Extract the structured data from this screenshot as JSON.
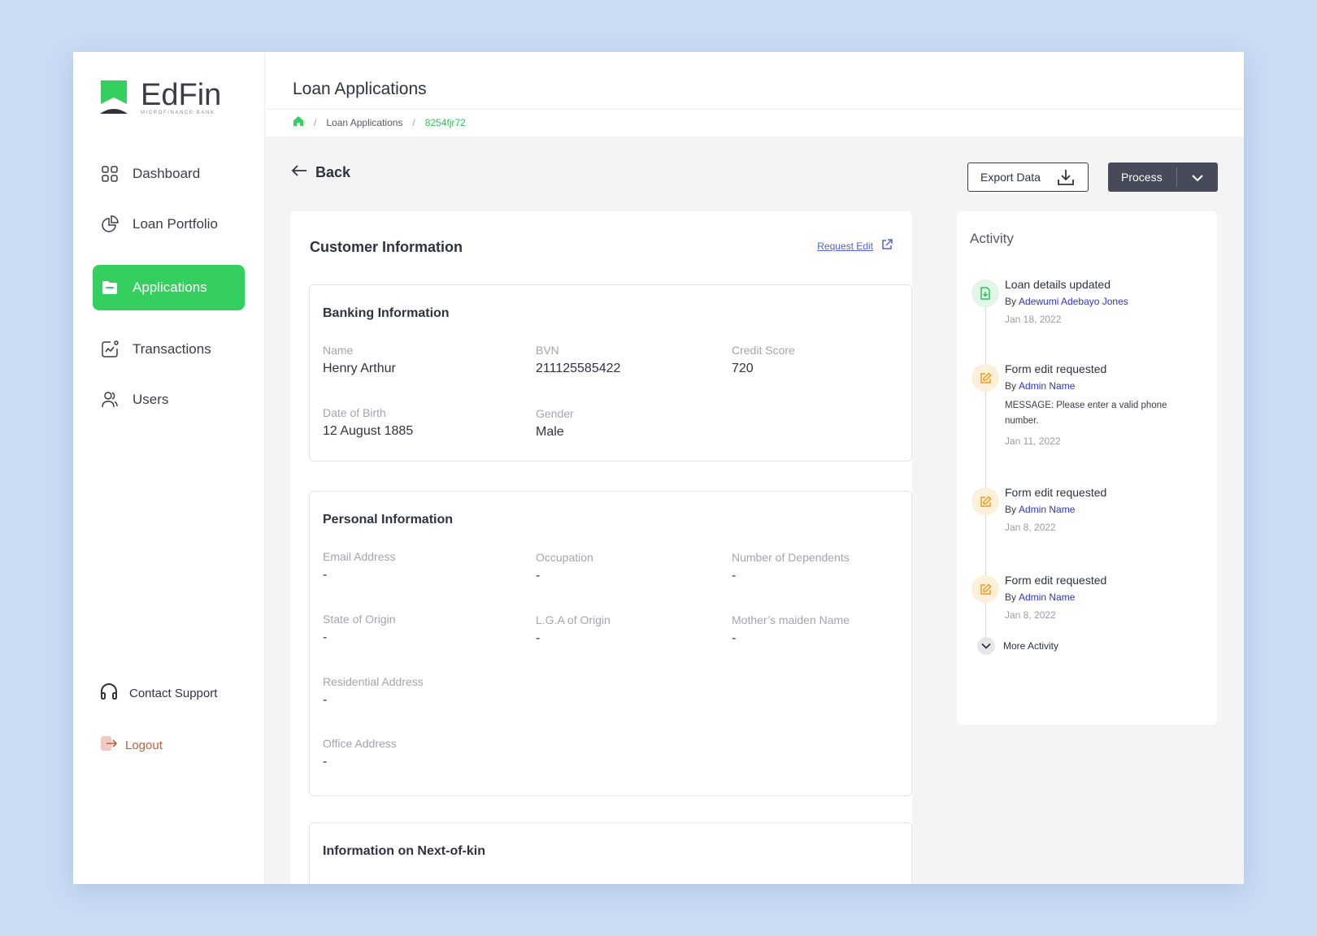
{
  "brand": {
    "name": "EdFin",
    "tagline": "MICROFINANCE BANK",
    "color": "#34cf5f"
  },
  "sidebar": {
    "items": [
      {
        "label": "Dashboard",
        "icon": "grid-icon"
      },
      {
        "label": "Loan Portfolio",
        "icon": "pie-chart-icon"
      },
      {
        "label": "Applications",
        "icon": "folder-icon",
        "active": true
      },
      {
        "label": "Transactions",
        "icon": "trend-chart-icon"
      },
      {
        "label": "Users",
        "icon": "users-icon"
      }
    ],
    "support_label": "Contact Support",
    "logout_label": "Logout"
  },
  "header": {
    "title": "Loan Applications",
    "breadcrumb": {
      "section": "Loan Applications",
      "current": "8254fjr72"
    }
  },
  "toolbar": {
    "back_label": "Back",
    "export_label": "Export Data",
    "process_label": "Process"
  },
  "customer": {
    "title": "Customer Information",
    "request_edit_label": "Request Edit",
    "banking": {
      "title": "Banking  Information",
      "name_label": "Name",
      "name": "Henry Arthur",
      "bvn_label": "BVN",
      "bvn": "211125585422",
      "credit_label": "Credit Score",
      "credit": "720",
      "dob_label": "Date of Birth",
      "dob": "12 August 1885",
      "gender_label": "Gender",
      "gender": "Male"
    },
    "personal": {
      "title": "Personal Information",
      "email_label": "Email Address",
      "email": "-",
      "occupation_label": "Occupation",
      "occupation": "-",
      "dependents_label": "Number of Dependents",
      "dependents": "-",
      "state_label": "State of Origin",
      "state": "-",
      "lga_label": "L.G.A of  Origin",
      "lga": "-",
      "maiden_label": "Mother’s maiden Name",
      "maiden": "-",
      "residential_label": "Residential Address",
      "residential": "-",
      "office_label": "Office Address",
      "office": "-"
    },
    "next_of_kin": {
      "title": "Information on Next-of-kin"
    }
  },
  "activity": {
    "title": "Activity",
    "by_prefix": "By",
    "items": [
      {
        "title": "Loan details updated",
        "by": "Adewumi Adebayo Jones",
        "date": "Jan 18, 2022",
        "icon": "document-icon"
      },
      {
        "title": "Form edit requested",
        "by": "Admin Name",
        "message": "MESSAGE: Please enter a valid phone number.",
        "date": "Jan 11, 2022",
        "icon": "edit-icon"
      },
      {
        "title": "Form edit requested",
        "by": "Admin Name",
        "date": "Jan 8, 2022",
        "icon": "edit-icon"
      },
      {
        "title": "Form edit requested",
        "by": "Admin Name",
        "date": "Jan 8, 2022",
        "icon": "edit-icon"
      }
    ],
    "more_label": "More Activity"
  }
}
